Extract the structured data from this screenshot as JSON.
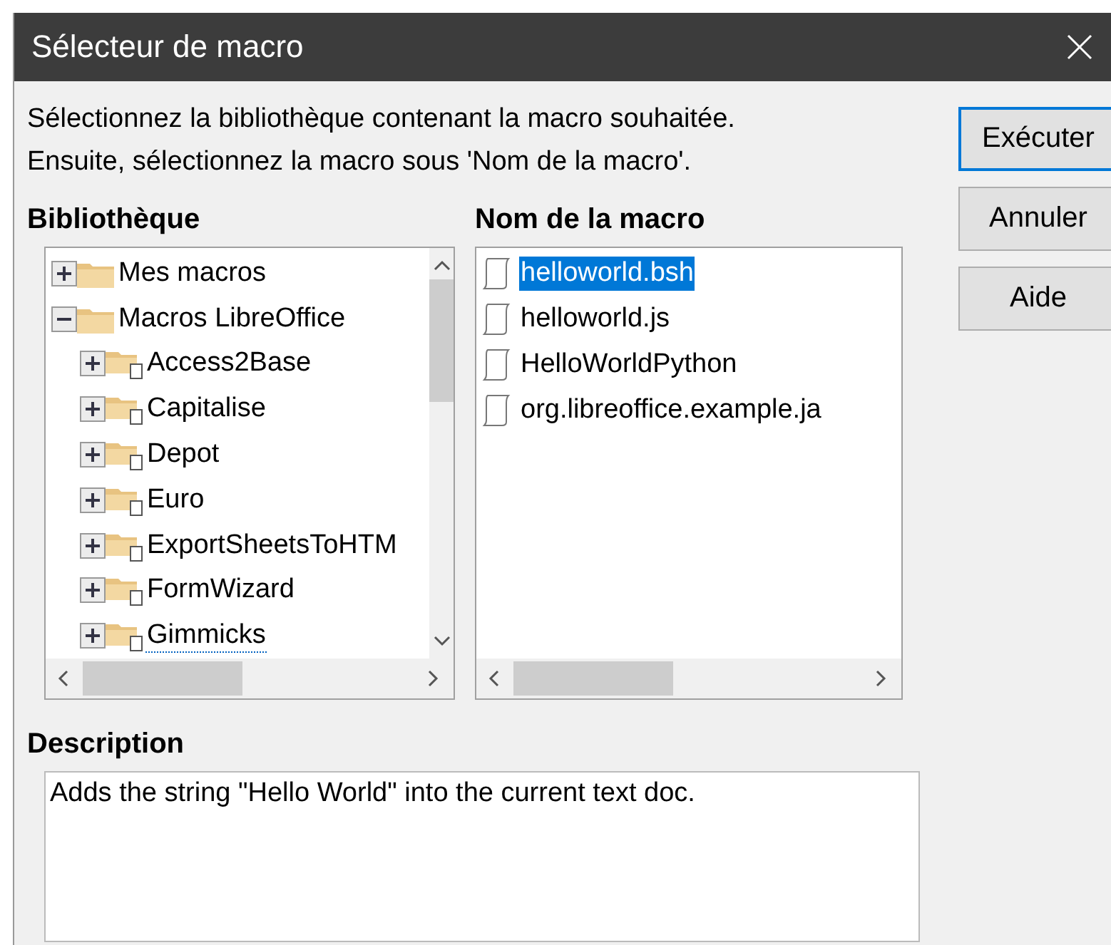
{
  "window": {
    "title": "Sélecteur de macro"
  },
  "instructions": [
    "Sélectionnez la bibliothèque contenant la macro souhaitée.",
    "Ensuite, sélectionnez la macro sous 'Nom de la macro'."
  ],
  "library": {
    "label": "Bibliothèque",
    "tree": [
      {
        "label": "Mes macros",
        "kind": "root",
        "expanded": false,
        "focused": false
      },
      {
        "label": "Macros LibreOffice",
        "kind": "root",
        "expanded": true,
        "focused": false,
        "children": [
          {
            "label": "Access2Base",
            "kind": "library",
            "expanded": false,
            "focused": false
          },
          {
            "label": "Capitalise",
            "kind": "library",
            "expanded": false,
            "focused": false
          },
          {
            "label": "Depot",
            "kind": "library",
            "expanded": false,
            "focused": false
          },
          {
            "label": "Euro",
            "kind": "library",
            "expanded": false,
            "focused": false
          },
          {
            "label": "ExportSheetsToHTM",
            "kind": "library",
            "expanded": false,
            "focused": false
          },
          {
            "label": "FormWizard",
            "kind": "library",
            "expanded": false,
            "focused": false
          },
          {
            "label": "Gimmicks",
            "kind": "library",
            "expanded": false,
            "focused": true
          }
        ]
      }
    ]
  },
  "macros": {
    "label": "Nom de la macro",
    "items": [
      {
        "label": "helloworld.bsh",
        "selected": true
      },
      {
        "label": "helloworld.js",
        "selected": false
      },
      {
        "label": "HelloWorldPython",
        "selected": false
      },
      {
        "label": "org.libreoffice.example.ja",
        "selected": false
      }
    ]
  },
  "buttons": [
    {
      "label": "Exécuter",
      "default": true
    },
    {
      "label": "Annuler",
      "default": false
    },
    {
      "label": "Aide",
      "default": false
    }
  ],
  "description": {
    "label": "Description",
    "text": "Adds the string \"Hello World\" into the current text doc."
  }
}
